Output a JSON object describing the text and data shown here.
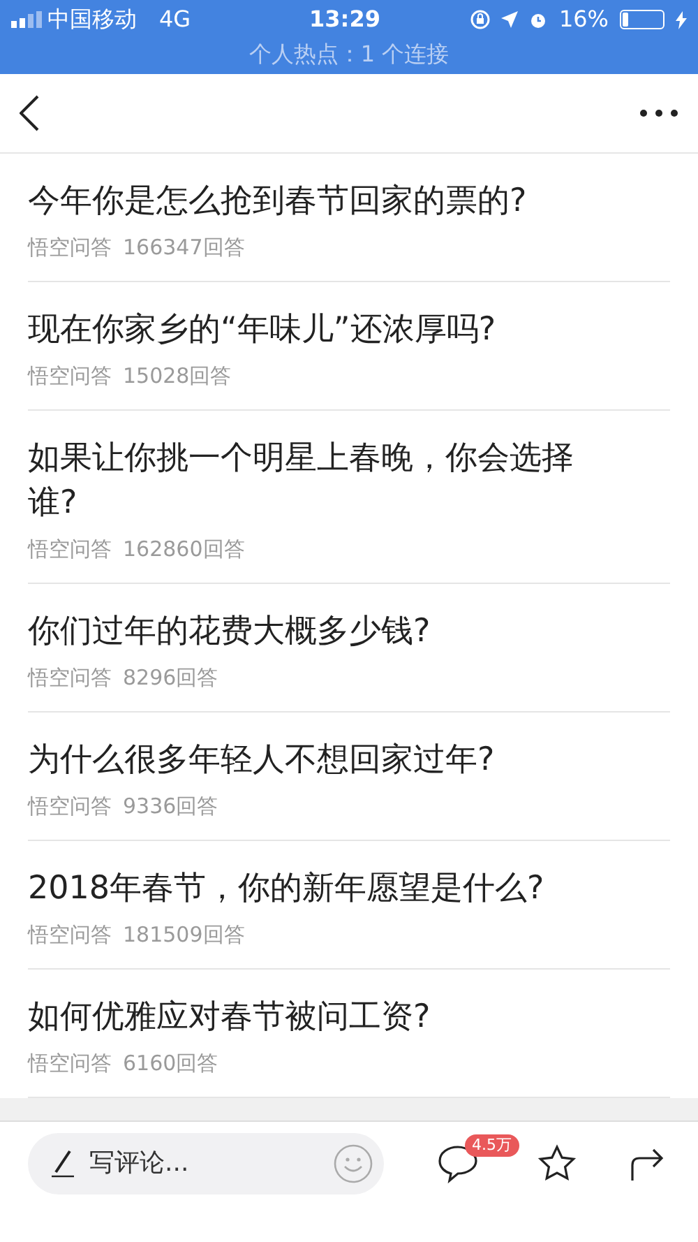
{
  "status_bar": {
    "carrier": "中国移动",
    "network": "4G",
    "time": "13:29",
    "battery_percent": "16%",
    "battery": {
      "level": 0.16
    }
  },
  "hotspot_banner": "个人热点：1 个连接",
  "questions": [
    {
      "title": "今年你是怎么抢到春节回家的票的?",
      "source": "悟空问答",
      "answers": "166347回答"
    },
    {
      "title": "现在你家乡的“年味儿”还浓厚吗?",
      "source": "悟空问答",
      "answers": "15028回答"
    },
    {
      "title": "如果让你挑一个明星上春晚，你会选择谁?",
      "source": "悟空问答",
      "answers": "162860回答"
    },
    {
      "title": "你们过年的花费大概多少钱?",
      "source": "悟空问答",
      "answers": "8296回答"
    },
    {
      "title": "为什么很多年轻人不想回家过年?",
      "source": "悟空问答",
      "answers": "9336回答"
    },
    {
      "title": "2018年春节，你的新年愿望是什么?",
      "source": "悟空问答",
      "answers": "181509回答"
    },
    {
      "title": "如何优雅应对春节被问工资?",
      "source": "悟空问答",
      "answers": "6160回答"
    }
  ],
  "bottom_bar": {
    "comment": {
      "placeholder": "写评论..."
    },
    "comment_count": "4.5万"
  }
}
